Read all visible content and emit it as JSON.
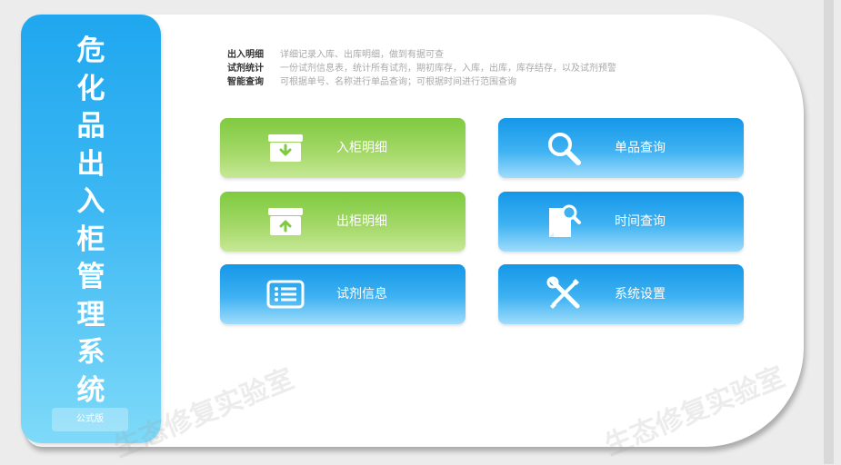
{
  "app": {
    "title_chars": [
      "危",
      "化",
      "品",
      "出",
      "入",
      "柜",
      "管",
      "理",
      "系",
      "统"
    ],
    "edition": "公式版"
  },
  "descriptions": [
    {
      "label": "出入明细",
      "text": "详细记录入库、出库明细，做到有据可查"
    },
    {
      "label": "试剂统计",
      "text": "一份试剂信息表，统计所有试剂，期初库存，入库，出库，库存结存，以及试剂预警"
    },
    {
      "label": "智能查询",
      "text": "可根据单号、名称进行单品查询；可根据时间进行范围查询"
    }
  ],
  "buttons": {
    "stock_in": {
      "label": "入柜明细",
      "icon": "box-in-icon"
    },
    "stock_out": {
      "label": "出柜明细",
      "icon": "box-out-icon"
    },
    "reagent_info": {
      "label": "试剂信息",
      "icon": "list-icon"
    },
    "item_query": {
      "label": "单品查询",
      "icon": "search-icon"
    },
    "time_query": {
      "label": "时间查询",
      "icon": "document-search-icon"
    },
    "settings": {
      "label": "系统设置",
      "icon": "tools-icon"
    }
  },
  "watermark": "生态修复实验室",
  "colors": {
    "green": "#8fd14f",
    "blue": "#1fa7ef",
    "sidebar_top": "#1fa7ef",
    "sidebar_bottom": "#7fdaf9"
  }
}
